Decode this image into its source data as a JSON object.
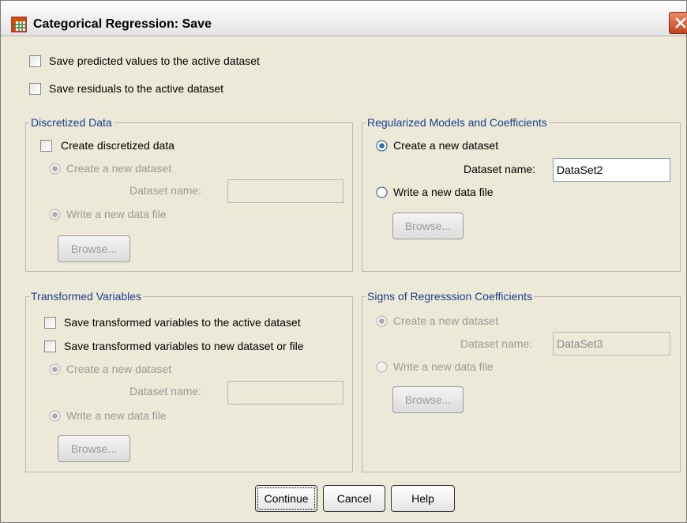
{
  "title": "Categorical Regression: Save",
  "top_options": {
    "save_predicted": "Save predicted values to the active dataset",
    "save_residuals": "Save residuals to the active dataset"
  },
  "discretized": {
    "title": "Discretized Data",
    "create": "Create discretized data",
    "new_dataset": "Create a new dataset",
    "dataset_name_label": "Dataset name:",
    "dataset_name_value": "",
    "write_file": "Write a new data file",
    "browse": "Browse..."
  },
  "regularized": {
    "title": "Regularized Models and Coefficients",
    "new_dataset": "Create a new dataset",
    "dataset_name_label": "Dataset name:",
    "dataset_name_value": "DataSet2",
    "write_file": "Write a new data file",
    "browse": "Browse..."
  },
  "transformed": {
    "title": "Transformed Variables",
    "save_active": "Save transformed variables to the active dataset",
    "save_new": "Save transformed variables to new dataset or file",
    "new_dataset": "Create a new dataset",
    "dataset_name_label": "Dataset name:",
    "dataset_name_value": "",
    "write_file": "Write a new data file",
    "browse": "Browse..."
  },
  "signs": {
    "title": "Signs of Regresssion Coefficients",
    "new_dataset": "Create a new dataset",
    "dataset_name_label": "Dataset name:",
    "dataset_name_value": "DataSet3",
    "write_file": "Write a new data file",
    "browse": "Browse..."
  },
  "buttons": {
    "continue": "Continue",
    "cancel": "Cancel",
    "help": "Help"
  },
  "icons": {
    "app": "spss-data-grid-icon",
    "close": "close-icon"
  }
}
